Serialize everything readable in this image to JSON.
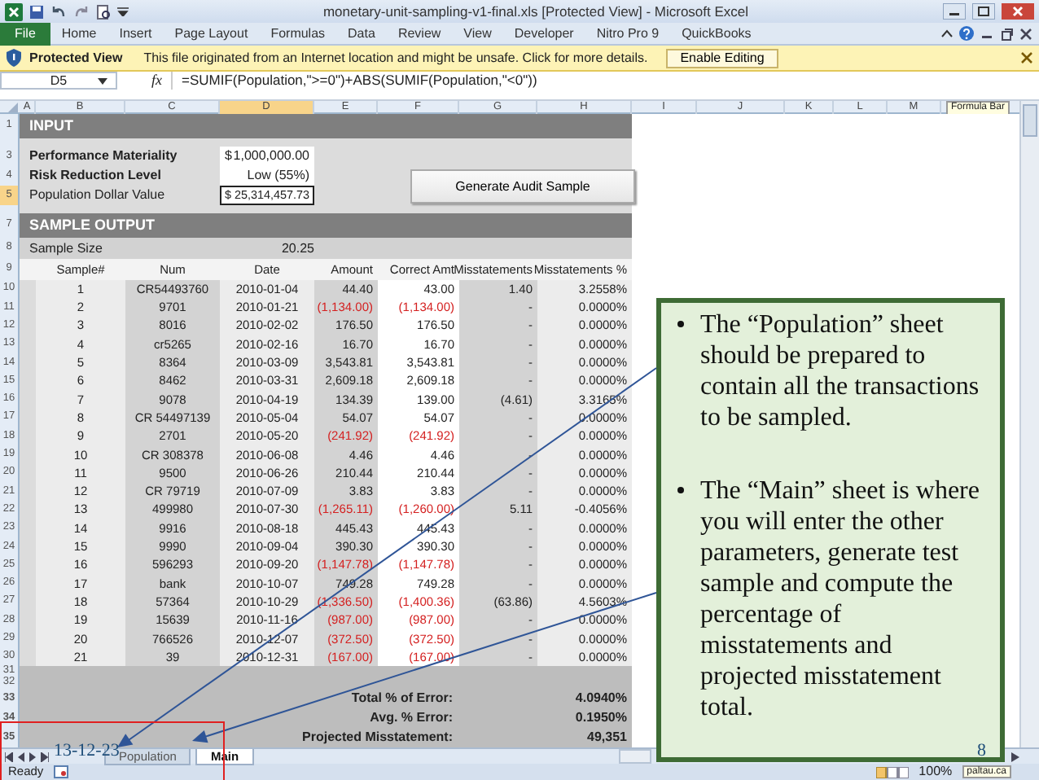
{
  "window": {
    "title": "monetary-unit-sampling-v1-final.xls  [Protected View]  -  Microsoft Excel"
  },
  "ribbon": {
    "file_tab": "File",
    "tabs": [
      "Home",
      "Insert",
      "Page Layout",
      "Formulas",
      "Data",
      "Review",
      "View",
      "Developer",
      "Nitro Pro 9",
      "QuickBooks"
    ]
  },
  "protected_view": {
    "title": "Protected View",
    "message": "This file originated from an Internet location and might be unsafe. Click for more details.",
    "button": "Enable Editing"
  },
  "formula_bar": {
    "name_box": "D5",
    "function_label": "fx",
    "formula": "=SUMIF(Population,\">=0\")+ABS(SUMIF(Population,\"<0\"))",
    "tooltip": "Formula Bar"
  },
  "column_headers": [
    {
      "label": "A",
      "selected": false
    },
    {
      "label": "B",
      "selected": false
    },
    {
      "label": "C",
      "selected": false
    },
    {
      "label": "D",
      "selected": true
    },
    {
      "label": "E",
      "selected": false
    },
    {
      "label": "F",
      "selected": false
    },
    {
      "label": "G",
      "selected": false
    },
    {
      "label": "H",
      "selected": false
    },
    {
      "label": "I",
      "selected": false
    },
    {
      "label": "J",
      "selected": false
    },
    {
      "label": "K",
      "selected": false
    },
    {
      "label": "L",
      "selected": false
    },
    {
      "label": "M",
      "selected": false
    }
  ],
  "sheet_rows": [
    {
      "row": "1",
      "selected": false,
      "kind": "section",
      "text": "INPUT"
    },
    {
      "kind": "spacer"
    },
    {
      "row": "3",
      "selected": false,
      "kind": "field",
      "label": "Performance Materiality",
      "label_bold": true,
      "currency": "$",
      "value": "1,000,000.00",
      "active": false
    },
    {
      "row": "4",
      "selected": false,
      "kind": "field",
      "label": "Risk Reduction Level",
      "label_bold": true,
      "value": "Low (55%)",
      "active": false,
      "button": "Generate Audit Sample"
    },
    {
      "row": "5",
      "selected": true,
      "kind": "field",
      "label": "Population Dollar Value",
      "label_bold": false,
      "currency": "$",
      "value": "25,314,457.73",
      "active": true
    },
    {
      "kind": "spacer"
    },
    {
      "row": "7",
      "selected": false,
      "kind": "section",
      "text": "SAMPLE OUTPUT"
    },
    {
      "row": "8",
      "selected": false,
      "kind": "summary",
      "label": "Sample Size",
      "value": "20.25"
    },
    {
      "row": "9",
      "selected": false,
      "kind": "header",
      "cells": [
        "Sample#",
        "Num",
        "Date",
        "Amount",
        "Correct Amt",
        "Misstatements",
        "Misstatements %"
      ]
    },
    {
      "row": "10",
      "selected": false,
      "kind": "data",
      "negative": false,
      "cells": [
        "1",
        "CR54493760",
        "2010-01-04",
        "44.40",
        "43.00",
        "1.40",
        "3.2558%"
      ]
    },
    {
      "row": "11",
      "selected": false,
      "kind": "data",
      "negative": true,
      "cells": [
        "2",
        "9701",
        "2010-01-21",
        "(1,134.00)",
        "(1,134.00)",
        "-",
        "0.0000%"
      ]
    },
    {
      "row": "12",
      "selected": false,
      "kind": "data",
      "negative": false,
      "cells": [
        "3",
        "8016",
        "2010-02-02",
        "176.50",
        "176.50",
        "-",
        "0.0000%"
      ]
    },
    {
      "row": "13",
      "selected": false,
      "kind": "data",
      "negative": false,
      "cells": [
        "4",
        "cr5265",
        "2010-02-16",
        "16.70",
        "16.70",
        "-",
        "0.0000%"
      ]
    },
    {
      "row": "14",
      "selected": false,
      "kind": "data",
      "negative": false,
      "cells": [
        "5",
        "8364",
        "2010-03-09",
        "3,543.81",
        "3,543.81",
        "-",
        "0.0000%"
      ]
    },
    {
      "row": "15",
      "selected": false,
      "kind": "data",
      "negative": false,
      "cells": [
        "6",
        "8462",
        "2010-03-31",
        "2,609.18",
        "2,609.18",
        "-",
        "0.0000%"
      ]
    },
    {
      "row": "16",
      "selected": false,
      "kind": "data",
      "negative": false,
      "cells": [
        "7",
        "9078",
        "2010-04-19",
        "134.39",
        "139.00",
        "(4.61)",
        "3.3165%"
      ]
    },
    {
      "row": "17",
      "selected": false,
      "kind": "data",
      "negative": false,
      "cells": [
        "8",
        "CR 54497139",
        "2010-05-04",
        "54.07",
        "54.07",
        "-",
        "0.0000%"
      ]
    },
    {
      "row": "18",
      "selected": false,
      "kind": "data",
      "negative": true,
      "cells": [
        "9",
        "2701",
        "2010-05-20",
        "(241.92)",
        "(241.92)",
        "-",
        "0.0000%"
      ]
    },
    {
      "row": "19",
      "selected": false,
      "kind": "data",
      "negative": false,
      "cells": [
        "10",
        "CR 308378",
        "2010-06-08",
        "4.46",
        "4.46",
        "-",
        "0.0000%"
      ]
    },
    {
      "row": "20",
      "selected": false,
      "kind": "data",
      "negative": false,
      "cells": [
        "11",
        "9500",
        "2010-06-26",
        "210.44",
        "210.44",
        "-",
        "0.0000%"
      ]
    },
    {
      "row": "21",
      "selected": false,
      "kind": "data",
      "negative": false,
      "cells": [
        "12",
        "CR 79719",
        "2010-07-09",
        "3.83",
        "3.83",
        "-",
        "0.0000%"
      ]
    },
    {
      "row": "22",
      "selected": false,
      "kind": "data",
      "negative": true,
      "cells": [
        "13",
        "499980",
        "2010-07-30",
        "(1,265.11)",
        "(1,260.00)",
        "5.11",
        "-0.4056%"
      ]
    },
    {
      "row": "23",
      "selected": false,
      "kind": "data",
      "negative": false,
      "cells": [
        "14",
        "9916",
        "2010-08-18",
        "445.43",
        "445.43",
        "-",
        "0.0000%"
      ]
    },
    {
      "row": "24",
      "selected": false,
      "kind": "data",
      "negative": false,
      "cells": [
        "15",
        "9990",
        "2010-09-04",
        "390.30",
        "390.30",
        "-",
        "0.0000%"
      ]
    },
    {
      "row": "25",
      "selected": false,
      "kind": "data",
      "negative": true,
      "cells": [
        "16",
        "596293",
        "2010-09-20",
        "(1,147.78)",
        "(1,147.78)",
        "-",
        "0.0000%"
      ]
    },
    {
      "row": "26",
      "selected": false,
      "kind": "data",
      "negative": false,
      "cells": [
        "17",
        "bank",
        "2010-10-07",
        "749.28",
        "749.28",
        "-",
        "0.0000%"
      ]
    },
    {
      "row": "27",
      "selected": false,
      "kind": "data",
      "negative": true,
      "cells": [
        "18",
        "57364",
        "2010-10-29",
        "(1,336.50)",
        "(1,400.36)",
        "(63.86)",
        "4.5603%"
      ]
    },
    {
      "row": "28",
      "selected": false,
      "kind": "data",
      "negative": true,
      "cells": [
        "19",
        "15639",
        "2010-11-16",
        "(987.00)",
        "(987.00)",
        "-",
        "0.0000%"
      ]
    },
    {
      "row": "29",
      "selected": false,
      "kind": "data",
      "negative": true,
      "cells": [
        "20",
        "766526",
        "2010-12-07",
        "(372.50)",
        "(372.50)",
        "-",
        "0.0000%"
      ]
    },
    {
      "row": "30",
      "selected": false,
      "kind": "data",
      "negative": true,
      "cells": [
        "21",
        "39",
        "2010-12-31",
        "(167.00)",
        "(167.00)",
        "-",
        "0.0000%"
      ]
    },
    {
      "row": "31",
      "selected": false,
      "kind": "band"
    },
    {
      "row": "32",
      "selected": false,
      "kind": "band"
    },
    {
      "row": "33",
      "selected": false,
      "kind": "total",
      "label": "Total % of Error:",
      "value": "4.0940%"
    },
    {
      "row": "34",
      "selected": false,
      "kind": "total",
      "label": "Avg. % Error:",
      "value": "0.1950%"
    },
    {
      "row": "35",
      "selected": false,
      "kind": "total",
      "label": "Projected Misstatement:",
      "value": "49,351"
    }
  ],
  "sheet_tabs": [
    {
      "label": "Population",
      "selected": false
    },
    {
      "label": "Main",
      "selected": true
    }
  ],
  "status_bar": {
    "mode": "Ready",
    "zoom": "100%",
    "tooltip": "paltau.ca"
  },
  "slide": {
    "bullets": [
      "The “Population” sheet should be prepared to contain all the transactions to be sampled.",
      "The “Main” sheet is where you will enter the other parameters, generate test sample and compute the percentage of misstatements and projected misstatement total."
    ],
    "date": "13-12-23",
    "page": "8"
  }
}
